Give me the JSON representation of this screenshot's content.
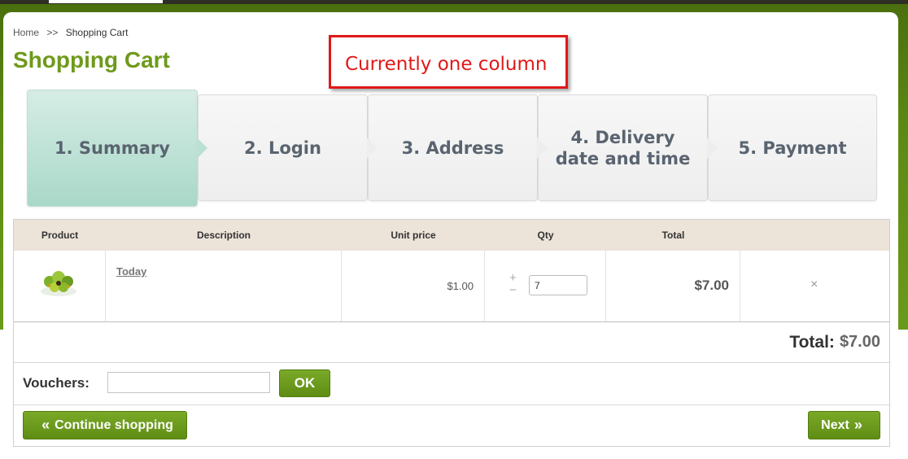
{
  "breadcrumb": {
    "home": "Home",
    "separator": ">>",
    "current": "Shopping Cart"
  },
  "page": {
    "title": "Shopping Cart"
  },
  "annotation": {
    "text": "Currently one column",
    "color": "#e01818"
  },
  "steps": [
    {
      "line1": "1. Summary",
      "line2": "",
      "active": true
    },
    {
      "line1": "2. Login",
      "line2": ""
    },
    {
      "line1": "3. Address",
      "line2": ""
    },
    {
      "line1": "4. Delivery",
      "line2": "date and time"
    },
    {
      "line1": "5. Payment",
      "line2": ""
    }
  ],
  "table": {
    "headers": {
      "product": "Product",
      "description": "Description",
      "unit_price": "Unit price",
      "qty": "Qty",
      "total": "Total"
    },
    "rows": [
      {
        "image_icon": "fruit-basket-icon",
        "name": "Today",
        "unit_price": "$1.00",
        "qty": "7",
        "total": "$7.00",
        "delete_icon": "close-icon"
      }
    ],
    "qty_plus": "+",
    "qty_minus": "−",
    "delete_glyph": "×"
  },
  "totals": {
    "label": "Total:",
    "value": "$7.00"
  },
  "voucher": {
    "label": "Vouchers:",
    "placeholder": "",
    "button": "OK"
  },
  "nav": {
    "continue": "Continue shopping",
    "next": "Next"
  },
  "colors": {
    "brand_green": "#6e9a1a",
    "button_green": "#5f8d14",
    "active_step": "#a9d8c8",
    "header_bg": "#ece3d9"
  }
}
